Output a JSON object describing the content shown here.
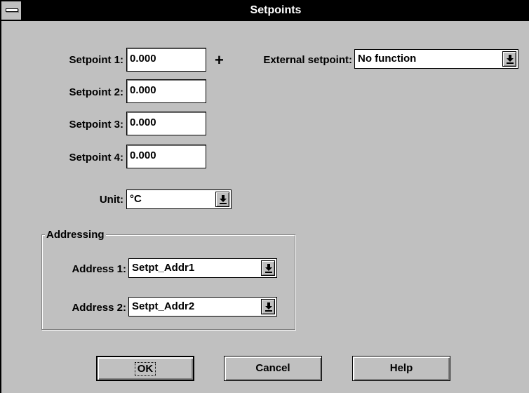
{
  "window": {
    "title": "Setpoints"
  },
  "setpoints": [
    {
      "label": "Setpoint 1:",
      "value": "0.000"
    },
    {
      "label": "Setpoint 2:",
      "value": "0.000"
    },
    {
      "label": "Setpoint 3:",
      "value": "0.000"
    },
    {
      "label": "Setpoint 4:",
      "value": "0.000"
    }
  ],
  "plus_symbol": "+",
  "external_setpoint": {
    "label": "External setpoint:",
    "value": "No function"
  },
  "unit": {
    "label": "Unit:",
    "value": "°C"
  },
  "addressing": {
    "title": "Addressing",
    "address1": {
      "label": "Address 1:",
      "value": "Setpt_Addr1"
    },
    "address2": {
      "label": "Address 2:",
      "value": "Setpt_Addr2"
    }
  },
  "buttons": {
    "ok": "OK",
    "cancel": "Cancel",
    "help": "Help"
  },
  "icons": {
    "dropdown": "chevron-down-icon",
    "system_menu": "system-menu-icon"
  }
}
